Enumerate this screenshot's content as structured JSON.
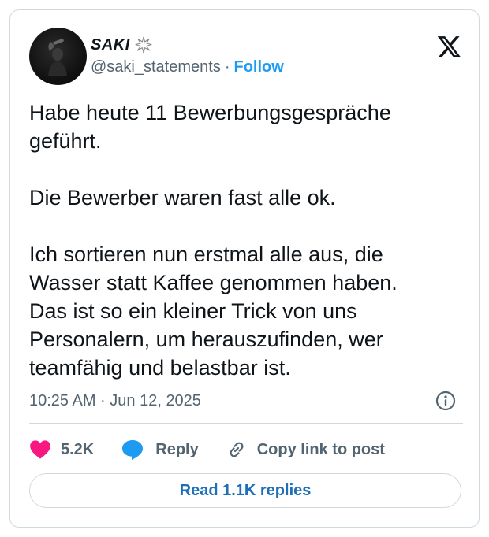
{
  "author": {
    "name": "SAKI",
    "handle": "@saki_statements",
    "separator": "·",
    "follow_label": "Follow",
    "name_icon": "spark-burst-icon",
    "avatar": "profile-photo"
  },
  "brand": {
    "logo": "x-logo-icon"
  },
  "tweet": {
    "line1": "Habe heute 11 Bewerbungsgespräche",
    "line2": "geführt.",
    "line3": "Die Bewerber waren fast alle ok.",
    "line4": "Ich sortieren nun erstmal alle aus, die",
    "line5": "Wasser statt Kaffee genommen haben.",
    "line6": "Das ist so ein kleiner Trick von uns",
    "line7": "Personalern, um herauszufinden, wer",
    "line8": "teamfähig und belastbar ist.",
    "timestamp": "10:25 AM · Jun 12, 2025",
    "info_icon": "info-icon"
  },
  "actions": {
    "like_count": "5.2K",
    "reply_label": "Reply",
    "copy_link_label": "Copy link to post",
    "read_replies_label": "Read 1.1K replies"
  },
  "colors": {
    "accent": "#1d9bf0",
    "like": "#f91880",
    "reply_bubble": "#1d9bf0",
    "muted_text": "#536471",
    "border": "#cfd9de"
  }
}
